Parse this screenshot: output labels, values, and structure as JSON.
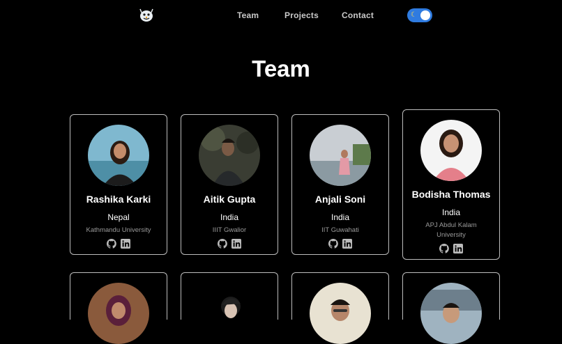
{
  "nav": {
    "links": [
      {
        "label": "Team"
      },
      {
        "label": "Projects"
      },
      {
        "label": "Contact"
      }
    ],
    "theme_icon": "moon-icon"
  },
  "page": {
    "title": "Team"
  },
  "colors": {
    "background": "#000000",
    "toggle": "#2f7be0",
    "card_border": "#bdbdbd"
  },
  "members": [
    {
      "name": "Rashika Karki",
      "country": "Nepal",
      "university": "Kathmandu University"
    },
    {
      "name": "Aitik Gupta",
      "country": "India",
      "university": "IIIT Gwalior"
    },
    {
      "name": "Anjali Soni",
      "country": "India",
      "university": "IIT Guwahati"
    },
    {
      "name": "Bodisha Thomas",
      "country": "India",
      "university": "APJ Abdul Kalam University"
    }
  ],
  "icons": {
    "github": "github-icon",
    "linkedin": "linkedin-icon"
  }
}
